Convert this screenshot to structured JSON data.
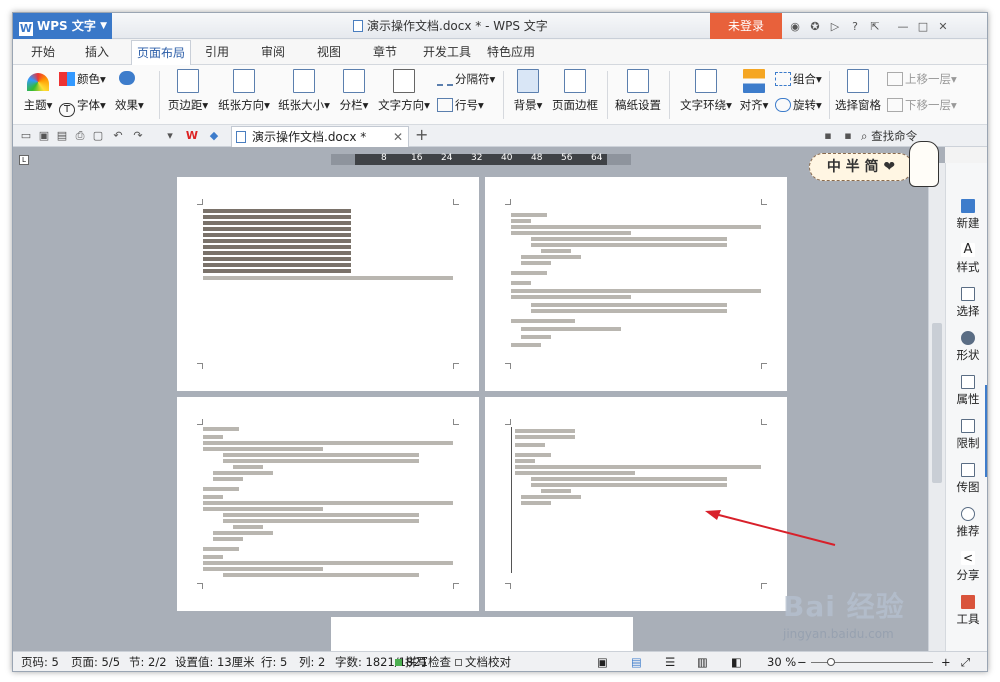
{
  "app": {
    "name": "WPS 文字",
    "title": "演示操作文档.docx * - WPS 文字",
    "login": "未登录",
    "doc_tab": "演示操作文档.docx *"
  },
  "tabs": [
    "开始",
    "插入",
    "页面布局",
    "引用",
    "审阅",
    "视图",
    "章节",
    "开发工具",
    "特色应用"
  ],
  "ribbon": {
    "theme": "主题",
    "colors": "颜色",
    "fonts": "字体",
    "effects": "效果",
    "margins": "页边距",
    "orientation": "纸张方向",
    "size": "纸张大小",
    "columns": "分栏",
    "text_dir": "文字方向",
    "breaks": "分隔符",
    "line_numbers": "行号",
    "background": "背景",
    "page_border": "页面边框",
    "paper_settings": "稿纸设置",
    "wrap": "文字环绕",
    "align": "对齐",
    "group": "组合",
    "rotate": "旋转",
    "selection_pane": "选择窗格",
    "bring_forward": "上移一层",
    "send_backward": "下移一层"
  },
  "quickbar": {
    "search": "查找命令"
  },
  "ruler": [
    "8",
    "16",
    "24",
    "32",
    "40",
    "48",
    "56",
    "64"
  ],
  "sidebar": [
    "新建",
    "样式",
    "选择",
    "形状",
    "属性",
    "限制",
    "传图",
    "推荐",
    "分享",
    "工具"
  ],
  "status": {
    "page_code": "页码: 5",
    "pages": "页面: 5/5",
    "section": "节: 2/2",
    "setting": "设置值: 13厘米",
    "row": "行: 5",
    "col": "列: 2",
    "words": "字数: 1821/1821",
    "spell": "拼写检查",
    "proof": "文档校对",
    "zoom": "30 %"
  },
  "badge": {
    "text": "中 半 简 ❤"
  },
  "watermark": {
    "logo": "Bai 经验",
    "url": "jingyan.baidu.com"
  },
  "colors": {
    "accent": "#3a78c8",
    "login": "#e8613b",
    "arrow": "#d8202a"
  }
}
